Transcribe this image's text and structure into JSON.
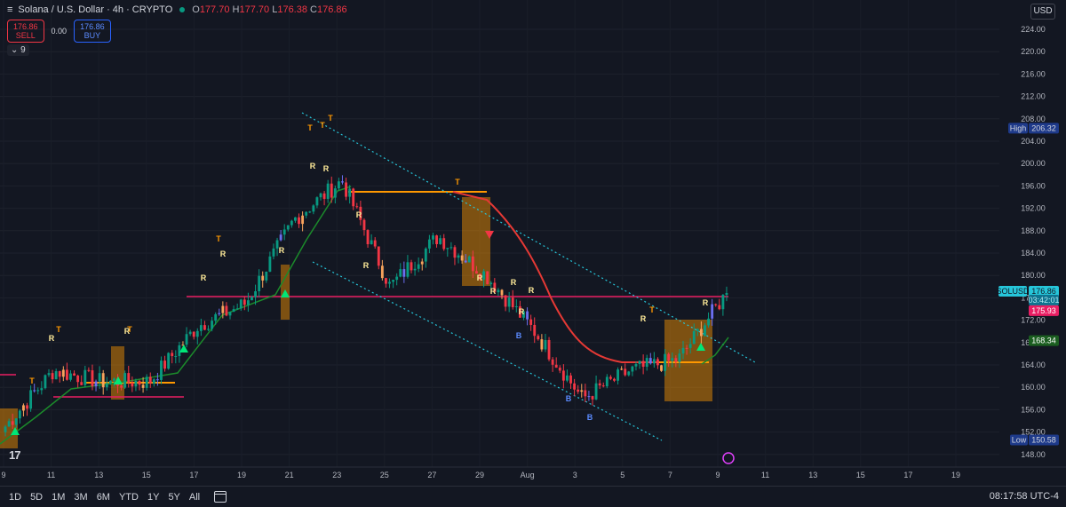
{
  "header": {
    "menu_icon": "hamburger-icon",
    "symbol": "Solana / U.S. Dollar · 4h · CRYPTO",
    "status_color": "#089981",
    "open_label": "O",
    "open": "177.70",
    "high_label": "H",
    "high": "177.70",
    "low_label": "L",
    "low": "176.38",
    "close_label": "C",
    "close": "176.86"
  },
  "trade": {
    "sell_price": "176.86",
    "sell_label": "SELL",
    "spread": "0.00",
    "buy_price": "176.86",
    "buy_label": "BUY"
  },
  "indicator_count": "9",
  "currency": "USD",
  "price_axis": {
    "ticks": [
      "224.00",
      "220.00",
      "216.00",
      "212.00",
      "208.00",
      "204.00",
      "200.00",
      "196.00",
      "192.00",
      "188.00",
      "184.00",
      "180.00",
      "176.00",
      "172.00",
      "168.00",
      "164.00",
      "160.00",
      "156.00",
      "152.00",
      "148.00"
    ],
    "labels": {
      "high_name": "High",
      "high_value": "206.32",
      "symbol_name": "SOLUSD",
      "symbol_price": "176.86",
      "countdown": "03:42:01",
      "red_price": "175.93",
      "green_price": "168.34",
      "low_name": "Low",
      "low_value": "150.58"
    }
  },
  "time_axis": [
    "9",
    "11",
    "13",
    "15",
    "17",
    "19",
    "21",
    "23",
    "25",
    "27",
    "29",
    "Aug",
    "3",
    "5",
    "7",
    "9",
    "11",
    "13",
    "15",
    "17",
    "19"
  ],
  "timeframes": [
    "1D",
    "5D",
    "1M",
    "3M",
    "6M",
    "YTD",
    "1Y",
    "5Y",
    "All"
  ],
  "clock": "08:17:58 UTC-4",
  "logo_text": "17",
  "colors": {
    "bg": "#131722",
    "up": "#089981",
    "down": "#f23645",
    "orange": "#ff9800",
    "magenta": "#e91e63",
    "red_line": "#e53935",
    "green_line": "#1b8a2b",
    "teal": "#26c6da"
  },
  "markers": [
    {
      "text": "T",
      "role": "top"
    },
    {
      "text": "R",
      "role": "resistance"
    },
    {
      "text": "B",
      "role": "bottom"
    }
  ],
  "chart_data": {
    "type": "candlestick",
    "x": [
      "Jul 9",
      "Jul 11",
      "Jul 13",
      "Jul 15",
      "Jul 17",
      "Jul 19",
      "Jul 21",
      "Jul 23",
      "Jul 25",
      "Jul 27",
      "Jul 29",
      "Aug 1",
      "Aug 3",
      "Aug 5",
      "Aug 7",
      "Aug 9"
    ],
    "close_approx": [
      153,
      163,
      161,
      161,
      171,
      175,
      190,
      197,
      178,
      187,
      180,
      170,
      158,
      163,
      165,
      176.86
    ],
    "high": 206.32,
    "low": 150.58,
    "last": 176.86,
    "ylim": [
      146,
      227
    ]
  }
}
